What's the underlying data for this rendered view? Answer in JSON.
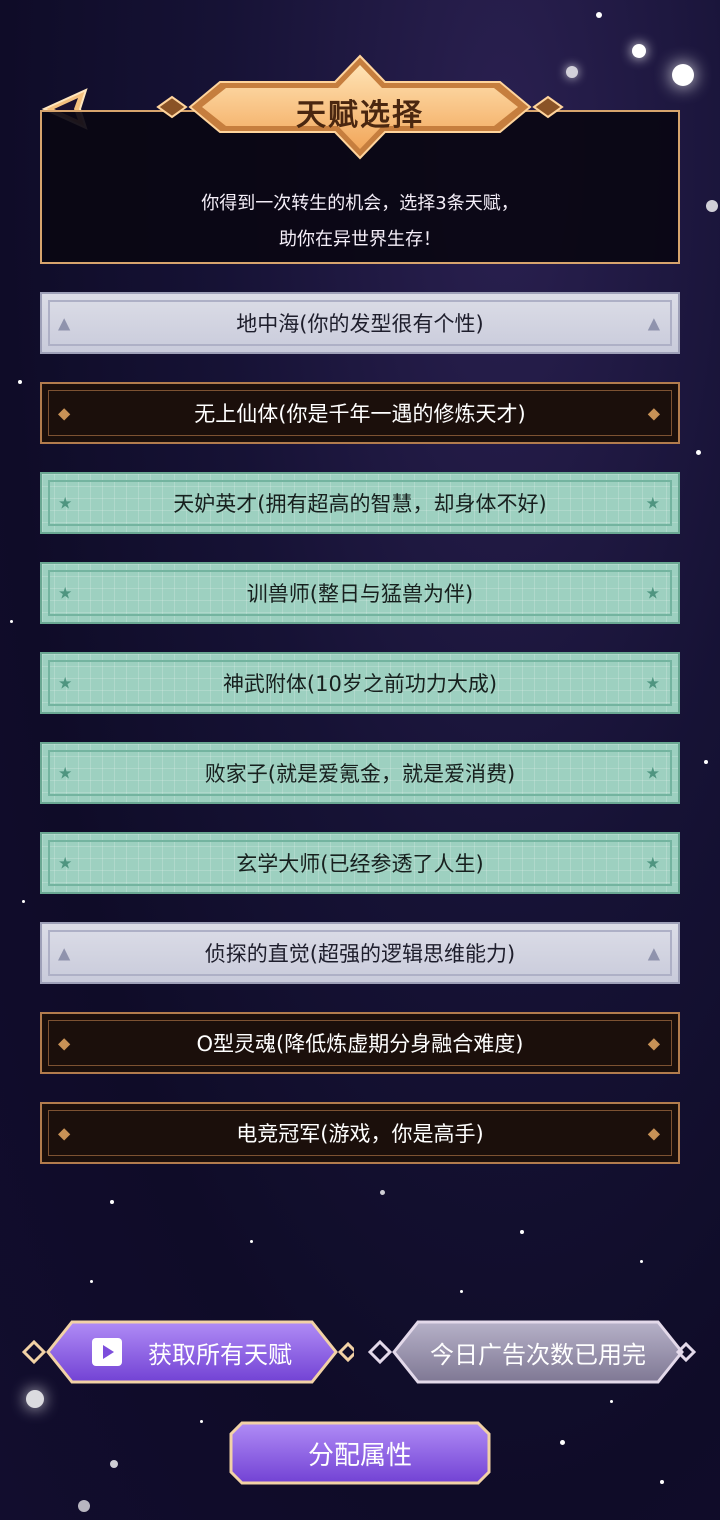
{
  "header": {
    "title": "天赋选择",
    "description_line1": "你得到一次转生的机会，选择3条天赋，",
    "description_line2": "助你在异世界生存！"
  },
  "talents": [
    {
      "label": "地中海(你的发型很有个性)",
      "style": "gray",
      "icon": "triangle-icon"
    },
    {
      "label": "无上仙体(你是千年一遇的修炼天才)",
      "style": "dark",
      "icon": "diamond-icon"
    },
    {
      "label": "天妒英才(拥有超高的智慧，却身体不好)",
      "style": "teal",
      "icon": "star-icon"
    },
    {
      "label": "训兽师(整日与猛兽为伴)",
      "style": "teal",
      "icon": "star-icon"
    },
    {
      "label": "神武附体(10岁之前功力大成)",
      "style": "teal",
      "icon": "star-icon"
    },
    {
      "label": "败家子(就是爱氪金，就是爱消费)",
      "style": "teal",
      "icon": "star-icon"
    },
    {
      "label": "玄学大师(已经参透了人生)",
      "style": "teal",
      "icon": "star-icon"
    },
    {
      "label": "侦探的直觉(超强的逻辑思维能力)",
      "style": "gray",
      "icon": "triangle-icon"
    },
    {
      "label": "O型灵魂(降低炼虚期分身融合难度)",
      "style": "dark",
      "icon": "diamond-icon"
    },
    {
      "label": "电竞冠军(游戏，你是高手)",
      "style": "dark",
      "icon": "diamond-icon"
    }
  ],
  "buttons": {
    "get_all_label": "获取所有天赋",
    "ad_used_label": "今日广告次数已用完",
    "allocate_label": "分配属性"
  },
  "colors": {
    "gold": "#f4b163",
    "teal": "#9dd0c0",
    "gray": "#d2d4e2",
    "dark": "#1b0f0b",
    "purple": "#8f63e6"
  }
}
